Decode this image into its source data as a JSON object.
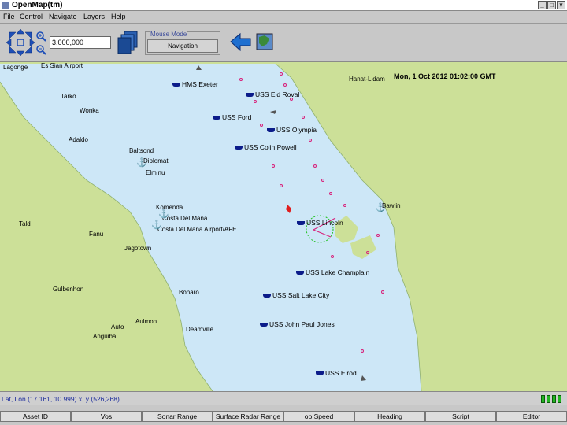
{
  "window": {
    "title": "OpenMap(tm)",
    "minimize": "_",
    "maximize": "□",
    "close": "×"
  },
  "menu": [
    "File",
    "Control",
    "Navigate",
    "Layers",
    "Help"
  ],
  "toolbar": {
    "zoom_value": "3,000,000",
    "mouse_mode_label": "Mouse Mode",
    "mode_button": "Navigation"
  },
  "map": {
    "time": "Mon, 1 Oct 2012 01:02:00 GMT",
    "colors": {
      "land": "#cce098",
      "water": "#cde7f7",
      "ship": "#0b1c8a",
      "contacts": "#d8207a"
    },
    "places": [
      "Lagonge",
      "Es Sian Airport",
      "Tarko",
      "Wonka",
      "Adaldo",
      "Baltsond",
      "Diplomat",
      "Elminu",
      "Komenda",
      "Costa Del Mana",
      "Costa Del Mana Airport/AFE",
      "Fanu",
      "Jagotown",
      "Tald",
      "Gulbenhon",
      "Bonaro",
      "Aulmon",
      "Auto",
      "Anguiba",
      "Deamville",
      "Bawlin",
      "Hanat-Lidam"
    ],
    "ships": [
      "HMS Exeter",
      "USS Eld Roval",
      "USS Ford",
      "USS Olympia",
      "USS Colin Powell",
      "USS Lincoln",
      "USS Lake Champlain",
      "USS Salt Lake City",
      "USS John Paul Jones",
      "USS Elrod"
    ]
  },
  "status": {
    "text": "Lat, Lon (17.161, 10.999)   x, y (526,268)"
  },
  "columns": [
    "Asset ID",
    "Vos",
    "Sonar Range",
    "Surface Radar Range",
    "op Speed",
    "Heading",
    "Script",
    "Editor"
  ]
}
